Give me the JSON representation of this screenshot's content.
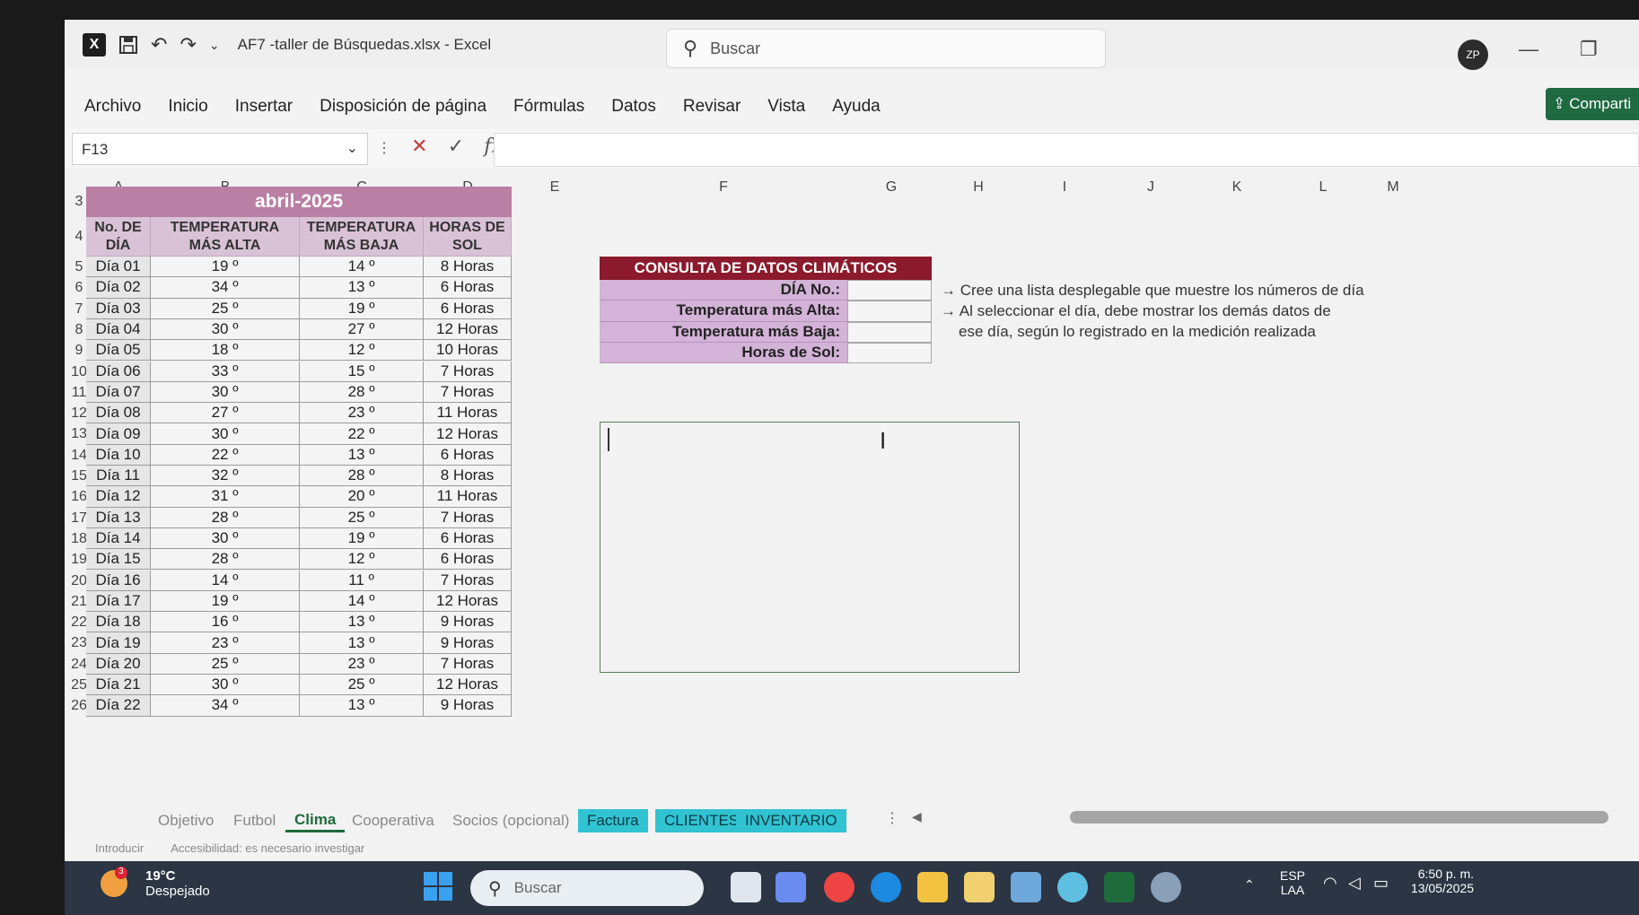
{
  "app": {
    "title": "AF7 -taller de  Búsquedas.xlsx  -  Excel",
    "search_placeholder": "Buscar",
    "avatar": "ZP",
    "share": "Comparti"
  },
  "menu": [
    "Archivo",
    "Inicio",
    "Insertar",
    "Disposición de página",
    "Fórmulas",
    "Datos",
    "Revisar",
    "Vista",
    "Ayuda"
  ],
  "formula_bar": {
    "name_box": "F13",
    "fx": "fx",
    "value": ""
  },
  "columns": [
    "A",
    "B",
    "C",
    "D",
    "E",
    "F",
    "G",
    "H",
    "I",
    "J",
    "K",
    "L",
    "M"
  ],
  "sheet": {
    "month": "abril-2025",
    "headers": [
      [
        "No. DE",
        "DÍA"
      ],
      [
        "TEMPERATURA",
        "MÁS ALTA"
      ],
      [
        "TEMPERATURA",
        "MÁS BAJA"
      ],
      [
        "HORAS DE",
        "SOL"
      ]
    ],
    "rows": [
      {
        "r": "5",
        "day": "Día 01",
        "hi": "19 º",
        "lo": "14 º",
        "sun": "8 Horas"
      },
      {
        "r": "6",
        "day": "Día 02",
        "hi": "34 º",
        "lo": "13 º",
        "sun": "6 Horas"
      },
      {
        "r": "7",
        "day": "Día 03",
        "hi": "25 º",
        "lo": "19 º",
        "sun": "6 Horas"
      },
      {
        "r": "8",
        "day": "Día 04",
        "hi": "30 º",
        "lo": "27 º",
        "sun": "12 Horas"
      },
      {
        "r": "9",
        "day": "Día 05",
        "hi": "18 º",
        "lo": "12 º",
        "sun": "10 Horas"
      },
      {
        "r": "10",
        "day": "Día 06",
        "hi": "33 º",
        "lo": "15 º",
        "sun": "7 Horas"
      },
      {
        "r": "11",
        "day": "Día 07",
        "hi": "30 º",
        "lo": "28 º",
        "sun": "7 Horas"
      },
      {
        "r": "12",
        "day": "Día 08",
        "hi": "27 º",
        "lo": "23 º",
        "sun": "11 Horas"
      },
      {
        "r": "13",
        "day": "Día 09",
        "hi": "30 º",
        "lo": "22 º",
        "sun": "12 Horas"
      },
      {
        "r": "14",
        "day": "Día 10",
        "hi": "22 º",
        "lo": "13 º",
        "sun": "6 Horas"
      },
      {
        "r": "15",
        "day": "Día 11",
        "hi": "32 º",
        "lo": "28 º",
        "sun": "8 Horas"
      },
      {
        "r": "16",
        "day": "Día 12",
        "hi": "31 º",
        "lo": "20 º",
        "sun": "11 Horas"
      },
      {
        "r": "17",
        "day": "Día 13",
        "hi": "28 º",
        "lo": "25 º",
        "sun": "7 Horas"
      },
      {
        "r": "18",
        "day": "Día 14",
        "hi": "30 º",
        "lo": "19 º",
        "sun": "6 Horas"
      },
      {
        "r": "19",
        "day": "Día 15",
        "hi": "28 º",
        "lo": "12 º",
        "sun": "6 Horas"
      },
      {
        "r": "20",
        "day": "Día 16",
        "hi": "14 º",
        "lo": "11 º",
        "sun": "7 Horas"
      },
      {
        "r": "21",
        "day": "Día 17",
        "hi": "19 º",
        "lo": "14 º",
        "sun": "12 Horas"
      },
      {
        "r": "22",
        "day": "Día 18",
        "hi": "16 º",
        "lo": "13 º",
        "sun": "9 Horas"
      },
      {
        "r": "23",
        "day": "Día 19",
        "hi": "23 º",
        "lo": "13 º",
        "sun": "9 Horas"
      },
      {
        "r": "24",
        "day": "Día 20",
        "hi": "25 º",
        "lo": "23 º",
        "sun": "7 Horas"
      },
      {
        "r": "25",
        "day": "Día 21",
        "hi": "30 º",
        "lo": "25 º",
        "sun": "12 Horas"
      },
      {
        "r": "26",
        "day": "Día 22",
        "hi": "34 º",
        "lo": "13 º",
        "sun": "9 Horas"
      }
    ],
    "consulta": {
      "title": "CONSULTA DE DATOS CLIMÁTICOS",
      "labels": [
        "DÍA No.:",
        "Temperatura más Alta:",
        "Temperatura más Baja:",
        "Horas de Sol:"
      ]
    },
    "notes": [
      "→ Cree una lista desplegable que muestre los números de día",
      "→ Al seleccionar el día, debe mostrar los demás datos de",
      "ese día, según lo registrado en la medición realizada"
    ]
  },
  "tabs": [
    {
      "label": "Objetivo",
      "style": "plain"
    },
    {
      "label": "Futbol",
      "style": "plain"
    },
    {
      "label": "Clima",
      "style": "active"
    },
    {
      "label": "Cooperativa",
      "style": "plain"
    },
    {
      "label": "Socios (opcional)",
      "style": "plain"
    },
    {
      "label": "Factura",
      "style": "colored"
    },
    {
      "label": "CLIENTES",
      "style": "colored"
    },
    {
      "label": "INVENTARIO",
      "style": "colored"
    }
  ],
  "status": {
    "mode": "Introducir",
    "accessibility": "Accesibilidad: es necesario investigar"
  },
  "taskbar": {
    "temp": "19°C",
    "weather": "Despejado",
    "badge": "3",
    "search": "Buscar",
    "lang1": "ESP",
    "lang2": "LAA",
    "time": "6:50 p. m.",
    "date": "13/05/2025"
  },
  "colors": {
    "month_header": "#b97fa5",
    "header": "#d9c2d6",
    "consulta_title": "#8b1a2c",
    "consulta_label": "#d3b3d7",
    "excel_green": "#1e6b3c",
    "tab_colored": "#31c3d1"
  }
}
